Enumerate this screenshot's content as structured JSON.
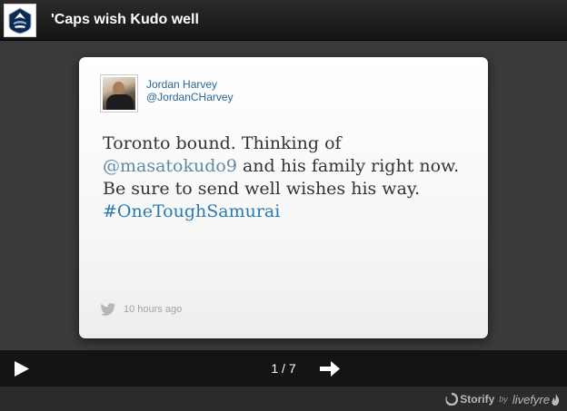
{
  "header": {
    "title": "'Caps wish Kudo well",
    "logo_icon": "whitecaps-crest-icon"
  },
  "tweet": {
    "author_name": "Jordan Harvey",
    "author_handle": "@JordanCHarvey",
    "text_part1": "Toronto bound. Thinking of ",
    "mention": "@masatokudo9",
    "text_part2": " and his family right now. Be sure to send well wishes his way. ",
    "hashtag": "#OneToughSamurai",
    "timestamp": "10 hours ago",
    "source_icon": "twitter-bird-icon"
  },
  "controls": {
    "counter": "1 / 7",
    "play_icon": "play-icon",
    "next_icon": "next-arrow-icon"
  },
  "credits": {
    "storify": "Storify",
    "by": "by",
    "livefyre": "livefyre"
  },
  "colors": {
    "background": "#3a3a3a",
    "header": "#1e1e1e",
    "control_bar": "#141414",
    "link": "#2a6496",
    "hashtag": "#2a7ab0"
  }
}
